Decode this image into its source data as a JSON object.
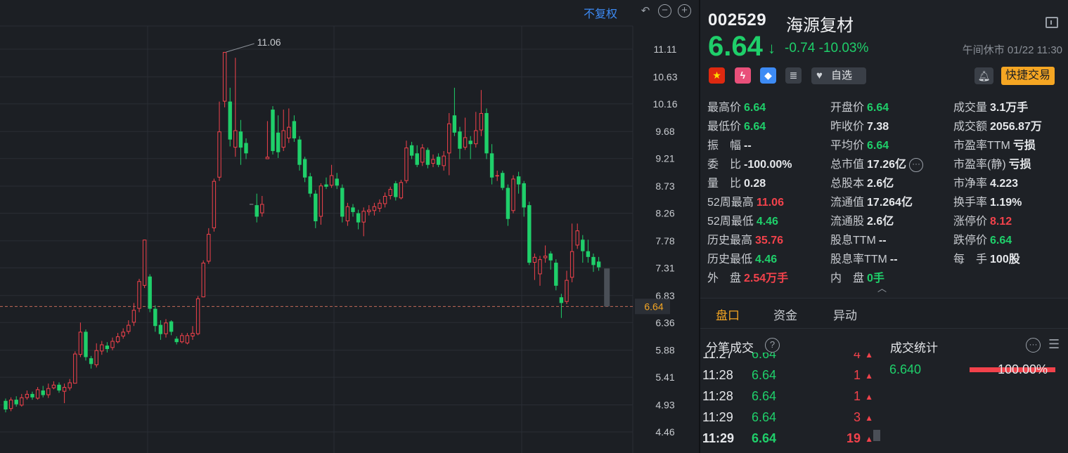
{
  "chart": {
    "adjust_label": "不复权",
    "high_marker_label": "11.06",
    "current_price_label": "6.64",
    "y_ticks": [
      "11.11",
      "10.63",
      "10.16",
      "9.68",
      "9.21",
      "8.73",
      "8.26",
      "7.78",
      "7.31",
      "6.83",
      "6.36",
      "5.88",
      "5.41",
      "4.93",
      "4.46"
    ],
    "y_tick_values": [
      11.11,
      10.63,
      10.16,
      9.68,
      9.21,
      8.73,
      8.26,
      7.78,
      7.31,
      6.83,
      6.36,
      5.88,
      5.41,
      4.93,
      4.46
    ],
    "current_price": 6.64,
    "colors": {
      "up": "#f2424b",
      "down": "#1fcf6a",
      "flat": "#8b9098",
      "dashed": "#c46b5a",
      "grid": "#2a2e35"
    },
    "candles": [
      [
        5.0,
        4.85,
        5.04,
        4.8
      ],
      [
        4.86,
        5.02,
        5.06,
        4.82
      ],
      [
        5.02,
        4.94,
        5.08,
        4.9
      ],
      [
        4.92,
        5.06,
        5.12,
        4.9
      ],
      [
        5.05,
        5.12,
        5.18,
        5.02
      ],
      [
        5.12,
        5.06,
        5.16,
        5.02
      ],
      [
        5.04,
        5.2,
        5.24,
        5.02
      ],
      [
        5.18,
        5.1,
        5.26,
        5.06
      ],
      [
        5.1,
        5.22,
        5.3,
        5.05
      ],
      [
        5.22,
        5.28,
        5.34,
        5.2
      ],
      [
        5.28,
        5.18,
        5.32,
        5.14
      ],
      [
        5.16,
        5.24,
        5.3,
        4.96
      ],
      [
        5.22,
        5.32,
        5.38,
        5.18
      ],
      [
        5.3,
        5.82,
        5.86,
        5.3
      ],
      [
        5.8,
        6.2,
        6.36,
        5.76
      ],
      [
        6.2,
        5.76,
        6.24,
        5.7
      ],
      [
        5.74,
        5.64,
        5.78,
        5.56
      ],
      [
        5.62,
        5.88,
        6.0,
        5.58
      ],
      [
        5.86,
        5.98,
        6.04,
        5.8
      ],
      [
        5.96,
        5.9,
        6.02,
        5.84
      ],
      [
        5.92,
        6.04,
        6.1,
        5.88
      ],
      [
        6.02,
        6.12,
        6.18,
        6.0
      ],
      [
        6.12,
        6.2,
        6.26,
        6.08
      ],
      [
        6.2,
        6.32,
        6.4,
        6.16
      ],
      [
        6.36,
        6.58,
        6.7,
        6.3
      ],
      [
        6.6,
        7.08,
        7.12,
        6.54
      ],
      [
        7.0,
        7.8,
        7.8,
        6.96
      ],
      [
        7.16,
        6.6,
        7.2,
        6.54
      ],
      [
        6.6,
        6.3,
        6.66,
        6.2
      ],
      [
        6.32,
        6.16,
        6.4,
        6.06
      ],
      [
        6.16,
        6.36,
        6.42,
        6.1
      ],
      [
        6.38,
        6.2,
        6.4,
        6.14
      ],
      [
        6.08,
        6.02,
        6.12,
        5.98
      ],
      [
        6.02,
        6.14,
        6.18,
        6.0
      ],
      [
        6.0,
        6.14,
        6.18,
        5.98
      ],
      [
        6.12,
        6.18,
        6.3,
        6.06
      ],
      [
        6.16,
        6.78,
        6.82,
        6.14
      ],
      [
        6.8,
        7.4,
        7.44,
        6.8
      ],
      [
        7.42,
        7.9,
        8.0,
        7.38
      ],
      [
        8.0,
        8.82,
        8.86,
        7.94
      ],
      [
        8.88,
        9.68,
        10.2,
        8.82
      ],
      [
        10.2,
        11.06,
        11.06,
        10.1
      ],
      [
        10.2,
        9.54,
        10.44,
        9.42
      ],
      [
        9.4,
        9.7,
        10.96,
        9.24
      ],
      [
        9.68,
        9.4,
        9.88,
        9.1
      ],
      [
        9.48,
        9.3,
        9.56,
        9.2
      ],
      [
        8.42,
        8.42,
        8.42,
        8.42
      ],
      [
        8.4,
        8.2,
        8.6,
        8.1
      ],
      [
        8.26,
        8.42,
        8.56,
        8.2
      ],
      [
        9.2,
        9.24,
        9.86,
        9.2
      ],
      [
        10.06,
        9.34,
        10.12,
        9.28
      ],
      [
        9.66,
        9.32,
        9.96,
        9.22
      ],
      [
        9.4,
        9.7,
        10.06,
        9.34
      ],
      [
        9.56,
        9.76,
        10.08,
        9.48
      ],
      [
        9.86,
        9.56,
        9.96,
        9.5
      ],
      [
        9.54,
        9.1,
        9.6,
        9.0
      ],
      [
        9.2,
        8.88,
        9.24,
        8.8
      ],
      [
        8.9,
        8.6,
        8.96,
        8.54
      ],
      [
        8.6,
        8.12,
        8.66,
        8.0
      ],
      [
        8.2,
        8.74,
        8.78,
        8.06
      ],
      [
        8.76,
        8.72,
        8.88,
        8.68
      ],
      [
        8.74,
        8.92,
        9.1,
        8.7
      ],
      [
        8.86,
        8.74,
        8.96,
        8.68
      ],
      [
        8.7,
        8.2,
        8.76,
        8.1
      ],
      [
        8.12,
        8.38,
        8.44,
        8.04
      ],
      [
        8.36,
        8.28,
        8.42,
        8.2
      ],
      [
        8.26,
        8.1,
        8.32,
        7.98
      ],
      [
        8.1,
        8.3,
        8.36,
        7.86
      ],
      [
        8.28,
        8.32,
        8.4,
        8.22
      ],
      [
        8.3,
        8.38,
        8.44,
        8.22
      ],
      [
        8.34,
        8.44,
        8.5,
        8.28
      ],
      [
        8.42,
        8.56,
        8.62,
        8.36
      ],
      [
        8.56,
        8.68,
        8.72,
        8.5
      ],
      [
        8.78,
        8.54,
        8.82,
        8.48
      ],
      [
        8.52,
        8.8,
        8.84,
        8.5
      ],
      [
        8.82,
        9.4,
        9.52,
        8.78
      ],
      [
        9.44,
        9.26,
        9.5,
        9.2
      ],
      [
        9.3,
        9.1,
        9.44,
        9.06
      ],
      [
        9.14,
        9.4,
        9.46,
        9.08
      ],
      [
        9.36,
        9.1,
        9.4,
        9.04
      ],
      [
        9.12,
        9.2,
        9.28,
        9.06
      ],
      [
        9.24,
        9.1,
        9.3,
        9.06
      ],
      [
        9.08,
        9.26,
        9.34,
        9.0
      ],
      [
        9.3,
        9.82,
        10.0,
        8.92
      ],
      [
        9.96,
        9.66,
        10.44,
        9.6
      ],
      [
        9.68,
        9.38,
        9.76,
        9.2
      ],
      [
        9.4,
        9.58,
        9.92,
        9.36
      ],
      [
        9.52,
        9.46,
        9.6,
        9.2
      ],
      [
        9.46,
        9.7,
        10.02,
        9.4
      ],
      [
        9.7,
        10.0,
        10.4,
        9.6
      ],
      [
        10.0,
        9.3,
        10.08,
        9.2
      ],
      [
        9.3,
        8.88,
        9.46,
        8.76
      ],
      [
        8.9,
        8.92,
        9.0,
        8.82
      ],
      [
        8.96,
        8.7,
        9.0,
        8.66
      ],
      [
        8.7,
        8.16,
        8.76,
        8.04
      ],
      [
        8.3,
        8.86,
        8.92,
        8.26
      ],
      [
        8.9,
        8.76,
        8.98,
        8.6
      ],
      [
        8.78,
        8.36,
        8.82,
        8.2
      ],
      [
        8.4,
        7.4,
        8.46,
        7.36
      ],
      [
        7.4,
        7.5,
        7.56,
        7.1
      ],
      [
        7.2,
        7.46,
        7.52,
        7.0
      ],
      [
        7.48,
        7.52,
        7.7,
        7.4
      ],
      [
        7.56,
        7.44,
        7.6,
        7.28
      ],
      [
        7.4,
        7.0,
        7.46,
        6.92
      ],
      [
        6.8,
        6.7,
        6.86,
        6.44
      ],
      [
        6.72,
        7.1,
        7.26,
        6.68
      ],
      [
        7.14,
        7.6,
        8.08,
        7.06
      ],
      [
        7.7,
        7.96,
        8.08,
        7.64
      ],
      [
        7.8,
        7.6,
        7.88,
        7.4
      ],
      [
        7.6,
        7.5,
        7.8,
        7.4
      ],
      [
        7.5,
        7.36,
        7.56,
        7.24
      ],
      [
        7.42,
        7.32,
        7.5,
        7.26
      ]
    ],
    "last_candle": [
      7.3,
      6.64,
      7.3,
      6.64
    ]
  },
  "quote": {
    "code": "002529",
    "name": "海源复材",
    "price": "6.64",
    "change": "-0.74",
    "change_pct": "-10.03%",
    "status_time": "午间休市 01/22 11:30",
    "watch_label": "自选",
    "trade_label": "快捷交易",
    "stats": [
      {
        "label": "最高价",
        "value": "6.64",
        "color": "green"
      },
      {
        "label": "开盘价",
        "value": "6.64",
        "color": "green"
      },
      {
        "label": "成交量",
        "value": "3.1万手",
        "color": "white"
      },
      {
        "label": "最低价",
        "value": "6.64",
        "color": "green"
      },
      {
        "label": "昨收价",
        "value": "7.38",
        "color": "white"
      },
      {
        "label": "成交额",
        "value": "2056.87万",
        "color": "white"
      },
      {
        "label": "振　幅",
        "value": "--",
        "color": "white"
      },
      {
        "label": "平均价",
        "value": "6.64",
        "color": "green"
      },
      {
        "label": "市盈率TTM",
        "value": "亏损",
        "color": "white"
      },
      {
        "label": "委　比",
        "value": "-100.00%",
        "color": "white"
      },
      {
        "label": "总市值",
        "value": "17.26亿",
        "color": "white"
      },
      {
        "label": "市盈率(静)",
        "value": "亏损",
        "color": "white"
      },
      {
        "label": "量　比",
        "value": "0.28",
        "color": "white"
      },
      {
        "label": "总股本",
        "value": "2.6亿",
        "color": "white"
      },
      {
        "label": "市净率",
        "value": "4.223",
        "color": "white"
      },
      {
        "label": "52周最高",
        "value": "11.06",
        "color": "red"
      },
      {
        "label": "流通值",
        "value": "17.264亿",
        "color": "white"
      },
      {
        "label": "换手率",
        "value": "1.19%",
        "color": "white"
      },
      {
        "label": "52周最低",
        "value": "4.46",
        "color": "green"
      },
      {
        "label": "流通股",
        "value": "2.6亿",
        "color": "white"
      },
      {
        "label": "涨停价",
        "value": "8.12",
        "color": "red"
      },
      {
        "label": "历史最高",
        "value": "35.76",
        "color": "red"
      },
      {
        "label": "股息TTM",
        "value": "--",
        "color": "white"
      },
      {
        "label": "跌停价",
        "value": "6.64",
        "color": "green"
      },
      {
        "label": "历史最低",
        "value": "4.46",
        "color": "green"
      },
      {
        "label": "股息率TTM",
        "value": "--",
        "color": "white"
      },
      {
        "label": "每　手",
        "value": "100股",
        "color": "white"
      },
      {
        "label": "外　盘",
        "value": "2.54万手",
        "color": "red"
      },
      {
        "label": "内　盘",
        "value": "0手",
        "color": "green"
      }
    ]
  },
  "tabs": [
    "盘口",
    "资金",
    "异动"
  ],
  "trades": {
    "title": "分笔成交",
    "rows": [
      {
        "time": "11:27",
        "price": "6.64",
        "vol": "4"
      },
      {
        "time": "11:28",
        "price": "6.64",
        "vol": "1"
      },
      {
        "time": "11:28",
        "price": "6.64",
        "vol": "1"
      },
      {
        "time": "11:29",
        "price": "6.64",
        "vol": "3"
      },
      {
        "time": "11:29",
        "price": "6.64",
        "vol": "19"
      }
    ]
  },
  "deal_stats": {
    "title": "成交统计",
    "price": "6.640",
    "pct": "100.00%"
  }
}
